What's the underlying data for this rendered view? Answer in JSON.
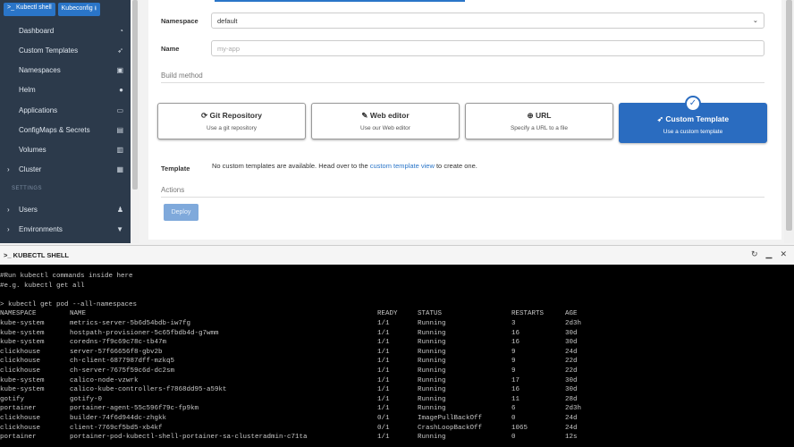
{
  "sidebar": {
    "kubectl_shell": "Kubectl shell",
    "kubeconfig": "Kubeconfig",
    "items": [
      {
        "label": "Dashboard",
        "icon": "tachometer-icon",
        "glyph": "◔"
      },
      {
        "label": "Custom Templates",
        "icon": "rocket-icon",
        "glyph": "➶"
      },
      {
        "label": "Namespaces",
        "icon": "cubes-icon",
        "glyph": "▣"
      },
      {
        "label": "Helm",
        "icon": "helm-icon",
        "glyph": "●"
      },
      {
        "label": "Applications",
        "icon": "laptop-icon",
        "glyph": "▭"
      },
      {
        "label": "ConfigMaps & Secrets",
        "icon": "file-icon",
        "glyph": "▤"
      },
      {
        "label": "Volumes",
        "icon": "database-icon",
        "glyph": "▥"
      },
      {
        "label": "Cluster",
        "icon": "server-icon",
        "glyph": "▦"
      }
    ],
    "settings_label": "SETTINGS",
    "settings_items": [
      {
        "label": "Users",
        "icon": "users-icon",
        "glyph": "♟"
      },
      {
        "label": "Environments",
        "icon": "plug-icon",
        "glyph": "▼"
      }
    ]
  },
  "form": {
    "namespace_label": "Namespace",
    "namespace_value": "default",
    "name_label": "Name",
    "name_placeholder": "my-app",
    "build_method_label": "Build method",
    "methods": [
      {
        "title": "Git Repository",
        "desc": "Use a git repository",
        "glyph": "⟳",
        "selected": false
      },
      {
        "title": "Web editor",
        "desc": "Use our Web editor",
        "glyph": "✎",
        "selected": false
      },
      {
        "title": "URL",
        "desc": "Specify a URL to a file",
        "glyph": "⊕",
        "selected": false
      },
      {
        "title": "Custom Template",
        "desc": "Use a custom template",
        "glyph": "➶",
        "selected": true
      }
    ],
    "template_label": "Template",
    "template_msg_pre": "No custom templates are available. Head over to the ",
    "template_link": "custom template view",
    "template_msg_post": " to create one.",
    "actions_label": "Actions",
    "deploy_label": "Deploy"
  },
  "shell": {
    "title": "KUBECTL SHELL",
    "comments": [
      "#Run kubectl commands inside here",
      "#e.g. kubectl get all"
    ],
    "command": "> kubectl get pod --all-namespaces",
    "headers": [
      "NAMESPACE",
      "NAME",
      "READY",
      "STATUS",
      "RESTARTS",
      "AGE"
    ],
    "rows": [
      [
        "kube-system",
        "metrics-server-5b6d54bdb-iw7fg",
        "1/1",
        "Running",
        "3",
        "2d3h"
      ],
      [
        "kube-system",
        "hostpath-provisioner-5c65fbdb4d-g7wmm",
        "1/1",
        "Running",
        "16",
        "30d"
      ],
      [
        "kube-system",
        "coredns-7f9c69c78c-tb47m",
        "1/1",
        "Running",
        "16",
        "30d"
      ],
      [
        "clickhouse",
        "server-57f66656f8-gbv2b",
        "1/1",
        "Running",
        "9",
        "24d"
      ],
      [
        "clickhouse",
        "ch-client-6877987dff-mzkq5",
        "1/1",
        "Running",
        "9",
        "22d"
      ],
      [
        "clickhouse",
        "ch-server-7675f59c6d-dc2sm",
        "1/1",
        "Running",
        "9",
        "22d"
      ],
      [
        "kube-system",
        "calico-node-vzwrk",
        "1/1",
        "Running",
        "17",
        "30d"
      ],
      [
        "kube-system",
        "calico-kube-controllers-f7868dd95-a59kt",
        "1/1",
        "Running",
        "16",
        "30d"
      ],
      [
        "gotify",
        "gotify-0",
        "1/1",
        "Running",
        "11",
        "28d"
      ],
      [
        "portainer",
        "portainer-agent-55c596f79c-fp9km",
        "1/1",
        "Running",
        "6",
        "2d3h"
      ],
      [
        "clickhouse",
        "builder-74f6d944dc-zhgkk",
        "0/1",
        "ImagePullBackOff",
        "0",
        "24d"
      ],
      [
        "clickhouse",
        "client-7769cf5bd5-xb4kf",
        "0/1",
        "CrashLoopBackOff",
        "1065",
        "24d"
      ],
      [
        "portainer",
        "portainer-pod-kubectl-shell-portainer-sa-clusteradmin-c71ta",
        "1/1",
        "Running",
        "0",
        "12s"
      ]
    ]
  }
}
